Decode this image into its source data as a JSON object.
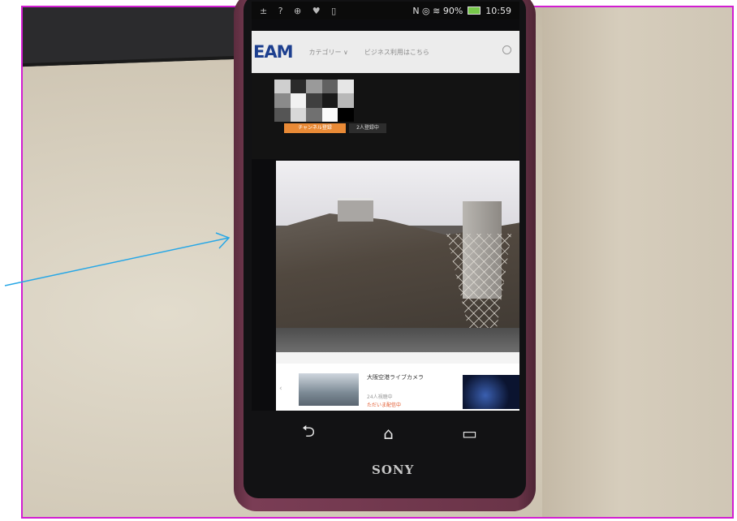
{
  "colors": {
    "frame_border": "#d21ed2",
    "arrow": "#27a7e6",
    "phone_body": "#6a3448",
    "logo_blue": "#1d3f8f",
    "subscribe_orange": "#e98a36",
    "live_red": "#e2572b"
  },
  "phone": {
    "brand": "SONY",
    "status_bar": {
      "left_icons": "± ? ⊕ ♥ ▯",
      "right": "N ◎ ≋ 90%",
      "battery": "90%",
      "time": "10:59"
    },
    "app": {
      "logo": "EAM",
      "nav_category": "カテゴリー ∨",
      "nav_business": "ビジネス利用はこちら",
      "search_icon": "search-icon"
    },
    "channel": {
      "subscribe_label": "チャンネル登録",
      "subscriber_badge": "2人登録中"
    },
    "video": {
      "description": "live camera feed"
    },
    "card": {
      "title": "大阪空港ライブカメラ",
      "views": "24人視聴中",
      "live": "ただいま配信中"
    },
    "nav_buttons": {
      "back_icon": "back-icon",
      "home_icon": "home-icon",
      "recent_icon": "recent-apps-icon",
      "back_glyph": "⮌",
      "home_glyph": "⌂",
      "recent_glyph": "▭"
    }
  }
}
